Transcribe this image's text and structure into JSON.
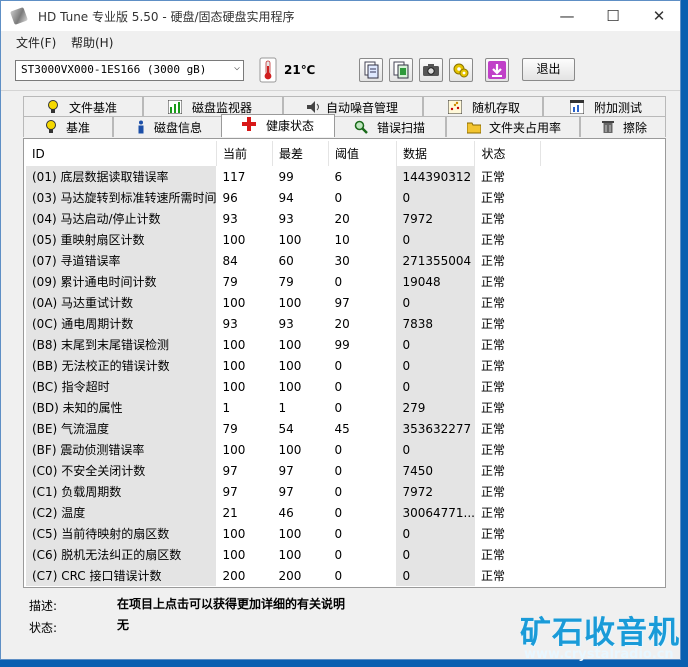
{
  "window": {
    "title": "HD Tune 专业版 5.50 - 硬盘/固态硬盘实用程序",
    "minimize": "—",
    "maximize": "☐",
    "close": "✕"
  },
  "menu": {
    "file": "文件(F)",
    "help": "帮助(H)"
  },
  "toolbar": {
    "drive": "ST3000VX000-1ES166 (3000 gB)",
    "temperature": "21℃",
    "exit": "退出",
    "icons": [
      "copy-text-icon",
      "copy-info-icon",
      "screenshot-icon",
      "options-icon",
      "save-icon"
    ]
  },
  "tabs": {
    "row1": [
      "文件基准",
      "磁盘监视器",
      "自动噪音管理",
      "随机存取",
      "附加测试"
    ],
    "row2": [
      "基准",
      "磁盘信息",
      "健康状态",
      "错误扫描",
      "文件夹占用率",
      "擦除"
    ],
    "active": "健康状态"
  },
  "health": {
    "columns": [
      "ID",
      "当前",
      "最差",
      "阈值",
      "数据",
      "状态"
    ],
    "rows": [
      {
        "id": "(01) 底层数据读取错误率",
        "current": "117",
        "worst": "99",
        "threshold": "6",
        "data": "144390312",
        "status": "正常"
      },
      {
        "id": "(03) 马达旋转到标准转速所需时间",
        "current": "96",
        "worst": "94",
        "threshold": "0",
        "data": "0",
        "status": "正常"
      },
      {
        "id": "(04) 马达启动/停止计数",
        "current": "93",
        "worst": "93",
        "threshold": "20",
        "data": "7972",
        "status": "正常"
      },
      {
        "id": "(05) 重映射扇区计数",
        "current": "100",
        "worst": "100",
        "threshold": "10",
        "data": "0",
        "status": "正常"
      },
      {
        "id": "(07) 寻道错误率",
        "current": "84",
        "worst": "60",
        "threshold": "30",
        "data": "271355004",
        "status": "正常"
      },
      {
        "id": "(09) 累计通电时间计数",
        "current": "79",
        "worst": "79",
        "threshold": "0",
        "data": "19048",
        "status": "正常"
      },
      {
        "id": "(0A) 马达重试计数",
        "current": "100",
        "worst": "100",
        "threshold": "97",
        "data": "0",
        "status": "正常"
      },
      {
        "id": "(0C) 通电周期计数",
        "current": "93",
        "worst": "93",
        "threshold": "20",
        "data": "7838",
        "status": "正常"
      },
      {
        "id": "(B8) 末尾到末尾错误检测",
        "current": "100",
        "worst": "100",
        "threshold": "99",
        "data": "0",
        "status": "正常"
      },
      {
        "id": "(BB) 无法校正的错误计数",
        "current": "100",
        "worst": "100",
        "threshold": "0",
        "data": "0",
        "status": "正常"
      },
      {
        "id": "(BC) 指令超时",
        "current": "100",
        "worst": "100",
        "threshold": "0",
        "data": "0",
        "status": "正常"
      },
      {
        "id": "(BD) 未知的属性",
        "current": "1",
        "worst": "1",
        "threshold": "0",
        "data": "279",
        "status": "正常"
      },
      {
        "id": "(BE) 气流温度",
        "current": "79",
        "worst": "54",
        "threshold": "45",
        "data": "353632277",
        "status": "正常"
      },
      {
        "id": "(BF) 震动侦测错误率",
        "current": "100",
        "worst": "100",
        "threshold": "0",
        "data": "0",
        "status": "正常"
      },
      {
        "id": "(C0) 不安全关闭计数",
        "current": "97",
        "worst": "97",
        "threshold": "0",
        "data": "7450",
        "status": "正常"
      },
      {
        "id": "(C1) 负载周期数",
        "current": "97",
        "worst": "97",
        "threshold": "0",
        "data": "7972",
        "status": "正常"
      },
      {
        "id": "(C2) 温度",
        "current": "21",
        "worst": "46",
        "threshold": "0",
        "data": "30064771...",
        "status": "正常"
      },
      {
        "id": "(C5) 当前待映射的扇区数",
        "current": "100",
        "worst": "100",
        "threshold": "0",
        "data": "0",
        "status": "正常"
      },
      {
        "id": "(C6) 脱机无法纠正的扇区数",
        "current": "100",
        "worst": "100",
        "threshold": "0",
        "data": "0",
        "status": "正常"
      },
      {
        "id": "(C7) CRC 接口错误计数",
        "current": "200",
        "worst": "200",
        "threshold": "0",
        "data": "0",
        "status": "正常"
      }
    ]
  },
  "description": {
    "desc_label": "描述:",
    "desc_value": "在项目上点击可以获得更加详细的有关说明",
    "status_label": "状态:",
    "status_value": "无"
  },
  "watermark": {
    "brand": "矿石收音机",
    "url": "www.crystalradio.cn"
  }
}
